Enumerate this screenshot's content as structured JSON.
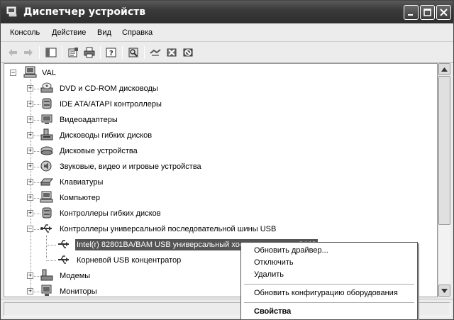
{
  "window": {
    "title": "Диспетчер устройств",
    "minimize_icon": "minimize-icon",
    "maximize_icon": "maximize-icon",
    "close_icon": "close-icon"
  },
  "menu": {
    "items": [
      {
        "label": "Консоль"
      },
      {
        "label": "Действие"
      },
      {
        "label": "Вид"
      },
      {
        "label": "Справка"
      }
    ]
  },
  "toolbar": {
    "icons": [
      "back-arrow-icon",
      "forward-arrow-icon",
      "show-hide-tree-icon",
      "properties-icon",
      "print-icon",
      "help-icon",
      "scan-hardware-icon",
      "update-driver-icon",
      "uninstall-icon",
      "disable-icon"
    ]
  },
  "tree": {
    "root": {
      "label": "VAL",
      "icon": "computer-icon"
    },
    "items": [
      {
        "label": "DVD и CD-ROM дисководы",
        "icon": "cdrom-icon",
        "expander": "+"
      },
      {
        "label": "IDE ATA/ATAPI контроллеры",
        "icon": "ide-controller-icon",
        "expander": "+"
      },
      {
        "label": "Видеоадаптеры",
        "icon": "display-adapter-icon",
        "expander": "+"
      },
      {
        "label": "Дисководы гибких дисков",
        "icon": "floppy-drive-icon",
        "expander": "+"
      },
      {
        "label": "Дисковые устройства",
        "icon": "disk-drive-icon",
        "expander": "+"
      },
      {
        "label": "Звуковые, видео и игровые устройства",
        "icon": "sound-icon",
        "expander": "+"
      },
      {
        "label": "Клавиатуры",
        "icon": "keyboard-icon",
        "expander": "+"
      },
      {
        "label": "Компьютер",
        "icon": "computer-category-icon",
        "expander": "+"
      },
      {
        "label": "Контроллеры гибких дисков",
        "icon": "floppy-controller-icon",
        "expander": "+"
      },
      {
        "label": "Контроллеры универсальной последовательной шины USB",
        "icon": "usb-icon",
        "expander": "−"
      }
    ],
    "usb_children": [
      {
        "label": "Intel(r) 82801BA/BAM USB универсальный хост-контроллер - 2442",
        "icon": "usb-device-icon",
        "selected": true
      },
      {
        "label": "Корневой USB концентратор",
        "icon": "usb-device-icon"
      }
    ],
    "after_items": [
      {
        "label": "Модемы",
        "icon": "modem-icon",
        "expander": "+"
      },
      {
        "label": "Мониторы",
        "icon": "monitor-icon",
        "expander": "+"
      }
    ]
  },
  "context_menu": {
    "items": [
      {
        "label": "Обновить драйвер..."
      },
      {
        "label": "Отключить"
      },
      {
        "label": "Удалить"
      },
      {
        "label": "Обновить конфигурацию оборудования"
      },
      {
        "label": "Свойства",
        "bold": true
      }
    ]
  }
}
